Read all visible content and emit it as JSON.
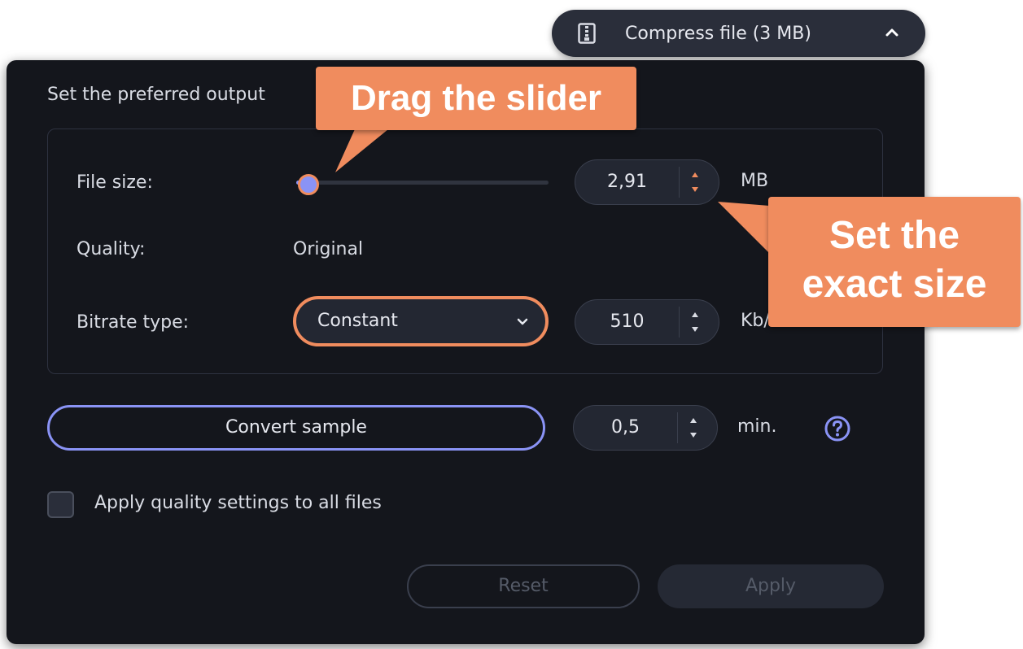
{
  "header": {
    "compress_label": "Compress file (3 MB)",
    "zip_icon": "zip-file-icon",
    "chevron_icon": "chevron-up-icon"
  },
  "panel": {
    "title": "Set the preferred output",
    "file_size": {
      "label": "File size:",
      "slider_fraction": 0.05,
      "value": "2,91",
      "unit": "MB"
    },
    "quality": {
      "label": "Quality:",
      "value": "Original"
    },
    "bitrate": {
      "label": "Bitrate type:",
      "selected": "Constant",
      "value": "510",
      "unit": "Kb/"
    },
    "sample": {
      "button_label": "Convert sample",
      "value": "0,5",
      "unit": "min.",
      "help_icon": "help-icon"
    },
    "checkbox_label": "Apply quality settings to all files",
    "reset_label": "Reset",
    "apply_label": "Apply"
  },
  "callouts": {
    "drag": "Drag the slider",
    "set_line1": "Set the",
    "set_line2": "exact size"
  },
  "colors": {
    "accent": "#8a93f5",
    "highlight": "#f08c5e",
    "panel_bg": "#14161c"
  }
}
